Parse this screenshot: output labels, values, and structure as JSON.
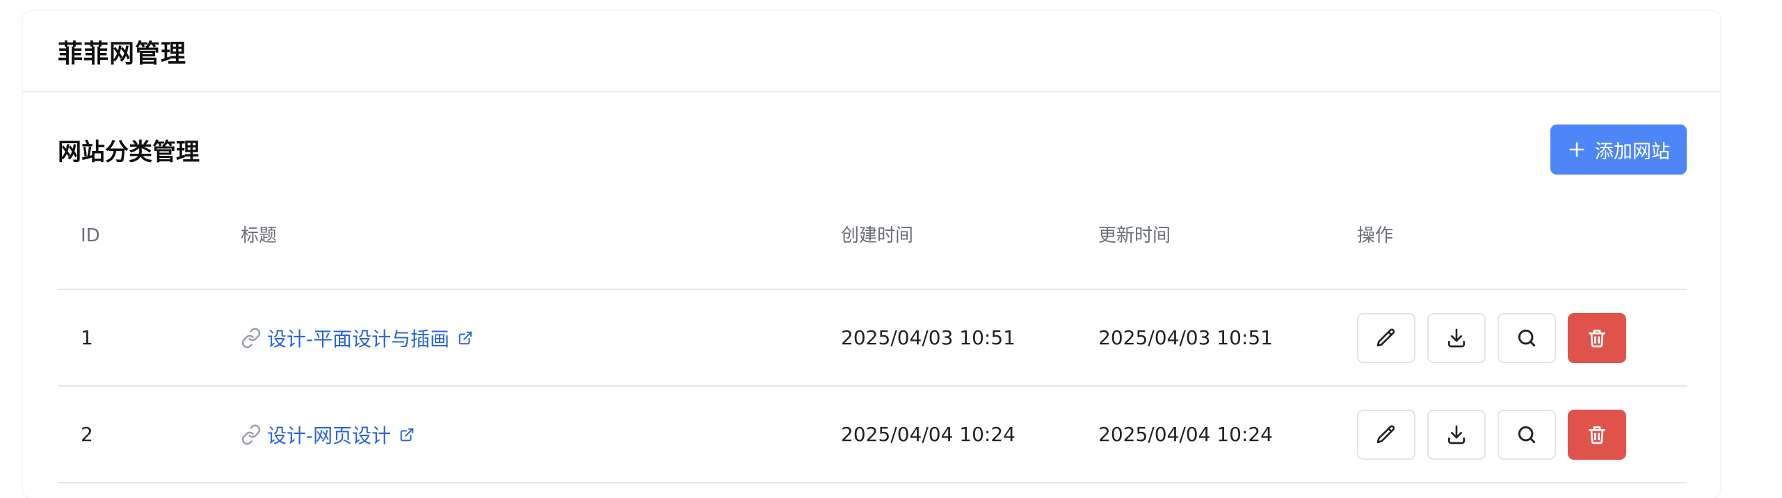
{
  "header": {
    "title": "菲菲网管理"
  },
  "section": {
    "title": "网站分类管理",
    "add_button": {
      "label": "添加网站",
      "icon": "plus-icon"
    }
  },
  "table": {
    "columns": [
      "ID",
      "标题",
      "创建时间",
      "更新时间",
      "操作"
    ],
    "rows": [
      {
        "id": "1",
        "title": "设计-平面设计与插画",
        "created": "2025/04/03 10:51",
        "updated": "2025/04/03 10:51"
      },
      {
        "id": "2",
        "title": "设计-网页设计",
        "created": "2025/04/04 10:24",
        "updated": "2025/04/04 10:24"
      }
    ],
    "actions": [
      "pencil-icon",
      "download-icon",
      "search-icon",
      "trash-icon"
    ]
  },
  "colors": {
    "primary": "#4f86f7",
    "link": "#2a64d8",
    "danger": "#e0534a"
  }
}
